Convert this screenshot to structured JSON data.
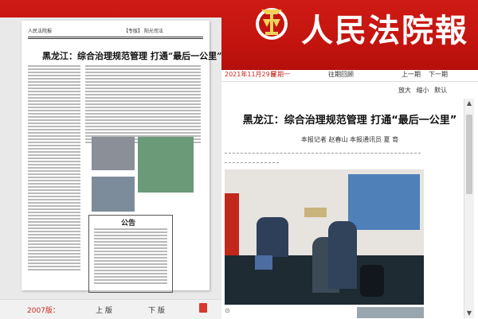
{
  "header": {
    "brand_title": "人民法院報",
    "emblem_icon": "court-emblem-icon",
    "bg_color": "#c3140f"
  },
  "left_panel": {
    "paper": {
      "masthead": "人民法院报",
      "section_tag": "【专版】 阳光司法",
      "headline": "黑龙江：综合治理规范管理 打通“最后一公里”",
      "notice_title": "公告"
    },
    "nav": {
      "year_text": "2007版：",
      "prev_label": "上 版",
      "next_label": "下 版",
      "pdf_icon": "pdf-icon"
    }
  },
  "article": {
    "date_text": "2021年11月29日",
    "weekday": "星期一",
    "date_link": "往期回顾",
    "prev_page": "上一期",
    "next_page": "下一期",
    "font_controls": [
      "放大",
      "缩小",
      "默认"
    ],
    "title": "黑龙江：综合治理规范管理 打通“最后一公里”",
    "byline": "本报记者 赵春山 本报通讯员 夏 育"
  },
  "photo": {
    "icon_name": "court-service-photo"
  },
  "scrollbar": {
    "up_icon": "up-arrow-icon",
    "down_icon": "down-arrow-icon"
  }
}
